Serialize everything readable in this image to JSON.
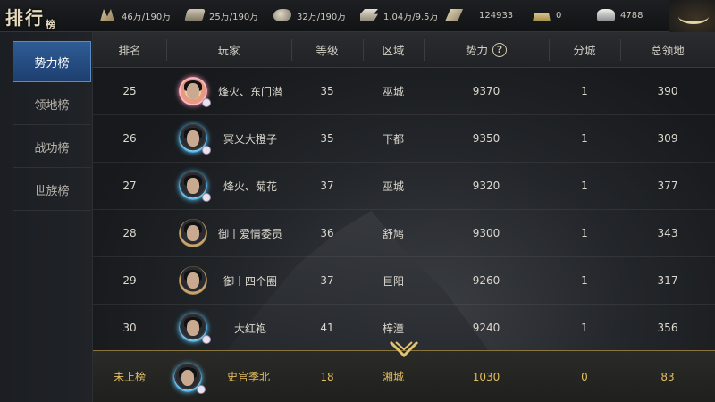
{
  "title": {
    "main": "排行",
    "sub": "榜"
  },
  "resources": [
    {
      "icon": "grain-icon",
      "value": "46万/190万"
    },
    {
      "icon": "wood-icon",
      "value": "25万/190万"
    },
    {
      "icon": "stone-icon",
      "value": "32万/190万"
    },
    {
      "icon": "iron-icon",
      "value": "1.04万/9.5万"
    },
    {
      "icon": "decree-icon",
      "value": "124933"
    },
    {
      "icon": "gold-icon",
      "value": "0"
    },
    {
      "icon": "silver-icon",
      "value": "4788"
    }
  ],
  "sidebar": {
    "items": [
      {
        "label": "势力榜",
        "active": true
      },
      {
        "label": "领地榜",
        "active": false
      },
      {
        "label": "战功榜",
        "active": false
      },
      {
        "label": "世族榜",
        "active": false
      }
    ]
  },
  "table": {
    "headers": [
      "排名",
      "玩家",
      "等级",
      "区域",
      "势力",
      "分城",
      "总领地"
    ],
    "help_symbol": "?",
    "rows": [
      {
        "rank": "25",
        "player": "烽火、东门潜",
        "level": "35",
        "region": "巫城",
        "power": "9370",
        "branch": "1",
        "territory": "390",
        "avatar": "pink"
      },
      {
        "rank": "26",
        "player": "冥乂大橙子",
        "level": "35",
        "region": "下都",
        "power": "9350",
        "branch": "1",
        "territory": "309",
        "avatar": "blue"
      },
      {
        "rank": "27",
        "player": "烽火、菊花",
        "level": "37",
        "region": "巫城",
        "power": "9320",
        "branch": "1",
        "territory": "377",
        "avatar": "blue"
      },
      {
        "rank": "28",
        "player": "御丨爱情委员",
        "level": "36",
        "region": "舒鸠",
        "power": "9300",
        "branch": "1",
        "territory": "343",
        "avatar": "gold"
      },
      {
        "rank": "29",
        "player": "御丨四个圈",
        "level": "37",
        "region": "巨阳",
        "power": "9260",
        "branch": "1",
        "territory": "317",
        "avatar": "gold"
      },
      {
        "rank": "30",
        "player": "大红袍",
        "level": "41",
        "region": "梓潼",
        "power": "9240",
        "branch": "1",
        "territory": "356",
        "avatar": "blue"
      }
    ],
    "self": {
      "rank": "未上榜",
      "player": "史官季北",
      "level": "18",
      "region": "湘城",
      "power": "1030",
      "branch": "0",
      "territory": "83",
      "avatar": "blue"
    }
  },
  "colors": {
    "accent_gold": "#e2bd62",
    "active_tab": "#2f5c96"
  }
}
